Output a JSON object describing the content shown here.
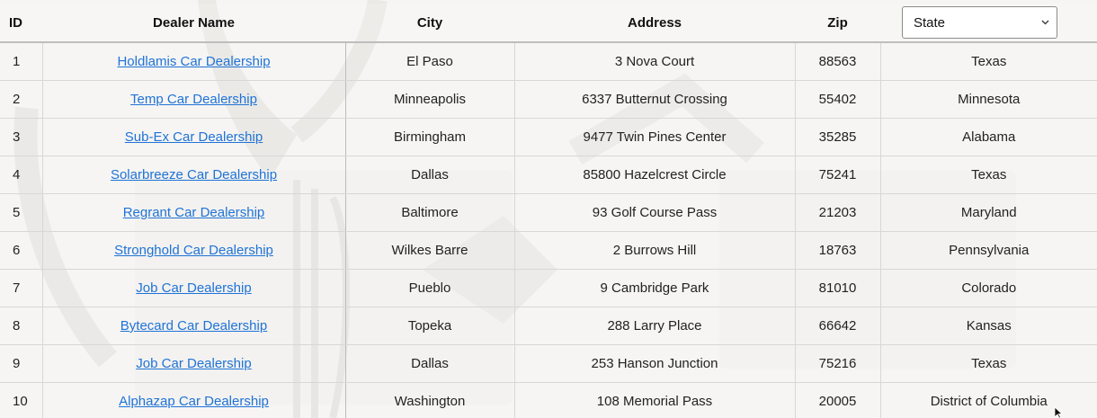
{
  "table": {
    "headers": {
      "id": "ID",
      "dealer_name": "Dealer Name",
      "city": "City",
      "address": "Address",
      "zip": "Zip"
    },
    "state_filter": {
      "selected": "State"
    },
    "rows": [
      {
        "id": "1",
        "dealer_name": "Holdlamis Car Dealership",
        "city": "El Paso",
        "address": "3 Nova Court",
        "zip": "88563",
        "state": "Texas"
      },
      {
        "id": "2",
        "dealer_name": "Temp Car Dealership",
        "city": "Minneapolis",
        "address": "6337 Butternut Crossing",
        "zip": "55402",
        "state": "Minnesota"
      },
      {
        "id": "3",
        "dealer_name": "Sub-Ex Car Dealership",
        "city": "Birmingham",
        "address": "9477 Twin Pines Center",
        "zip": "35285",
        "state": "Alabama"
      },
      {
        "id": "4",
        "dealer_name": "Solarbreeze Car Dealership",
        "city": "Dallas",
        "address": "85800 Hazelcrest Circle",
        "zip": "75241",
        "state": "Texas"
      },
      {
        "id": "5",
        "dealer_name": "Regrant Car Dealership",
        "city": "Baltimore",
        "address": "93 Golf Course Pass",
        "zip": "21203",
        "state": "Maryland"
      },
      {
        "id": "6",
        "dealer_name": "Stronghold Car Dealership",
        "city": "Wilkes Barre",
        "address": "2 Burrows Hill",
        "zip": "18763",
        "state": "Pennsylvania"
      },
      {
        "id": "7",
        "dealer_name": "Job Car Dealership",
        "city": "Pueblo",
        "address": "9 Cambridge Park",
        "zip": "81010",
        "state": "Colorado"
      },
      {
        "id": "8",
        "dealer_name": "Bytecard Car Dealership",
        "city": "Topeka",
        "address": "288 Larry Place",
        "zip": "66642",
        "state": "Kansas"
      },
      {
        "id": "9",
        "dealer_name": "Job Car Dealership",
        "city": "Dallas",
        "address": "253 Hanson Junction",
        "zip": "75216",
        "state": "Texas"
      },
      {
        "id": "10",
        "dealer_name": "Alphazap Car Dealership",
        "city": "Washington",
        "address": "108 Memorial Pass",
        "zip": "20005",
        "state": "District of Columbia"
      }
    ]
  },
  "colors": {
    "link": "#1f73d6",
    "background": "#f6f5f4"
  }
}
